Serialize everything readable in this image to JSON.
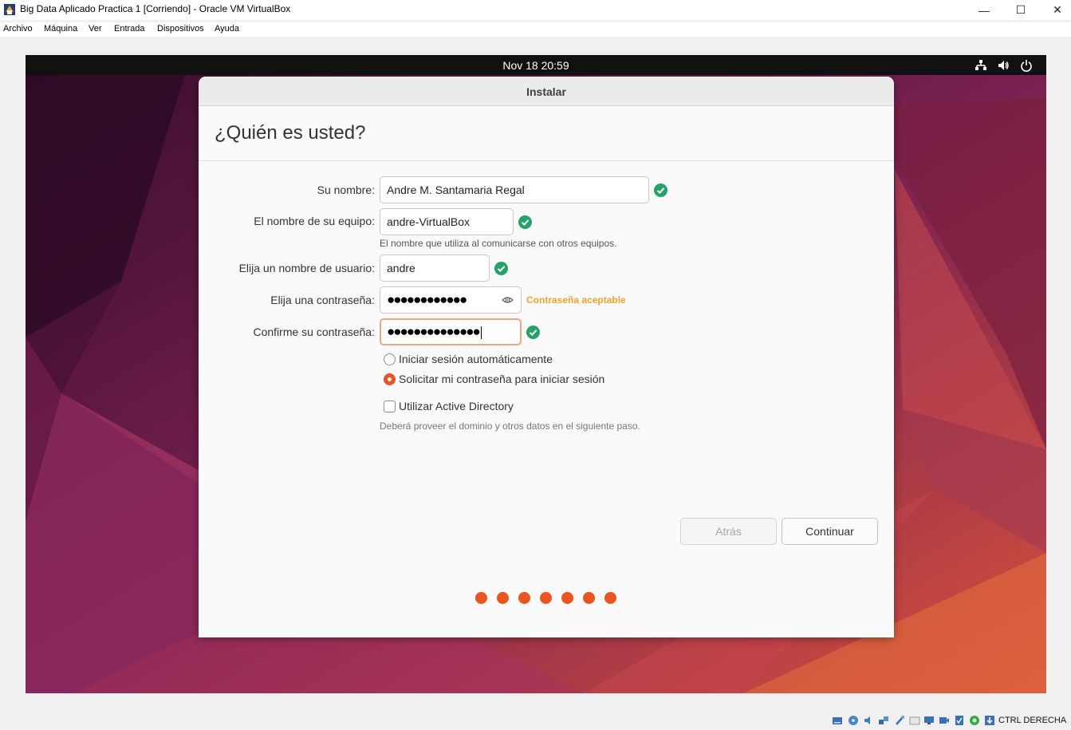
{
  "host": {
    "title": "Big Data Aplicado Practica 1 [Corriendo] - Oracle VM VirtualBox",
    "menu": [
      "Archivo",
      "Máquina",
      "Ver",
      "Entrada",
      "Dispositivos",
      "Ayuda"
    ],
    "window_controls": {
      "minimize": "—",
      "maximize": "☐",
      "close": "✕"
    },
    "host_key": "CTRL DERECHA",
    "status_icons": [
      "hard-disk-icon",
      "optical-drive-icon",
      "audio-icon",
      "network-icon",
      "usb-icon",
      "shared-folder-icon",
      "display-icon",
      "video-capture-icon",
      "recording-icon",
      "cpu-icon",
      "mouse-integration-icon",
      "keyboard-icon"
    ]
  },
  "guest": {
    "clock": "Nov 18  20:59",
    "tray_icons": [
      "network-wired-icon",
      "volume-icon",
      "power-icon"
    ]
  },
  "installer": {
    "window_title": "Instalar",
    "heading": "¿Quién es usted?",
    "fields": {
      "name": {
        "label": "Su nombre:",
        "value": "Andre M. Santamaria Regal"
      },
      "computer": {
        "label": "El nombre de su equipo:",
        "value": "andre-VirtualBox",
        "hint": "El nombre que utiliza al comunicarse con otros equipos."
      },
      "username": {
        "label": "Elija un nombre de usuario:",
        "value": "andre"
      },
      "password": {
        "label": "Elija una contraseña:",
        "value": "●●●●●●●●●●●●",
        "strength": "Contraseña aceptable"
      },
      "confirm": {
        "label": "Confirme su contraseña:",
        "value": "●●●●●●●●●●●●●●"
      }
    },
    "login_options": {
      "auto": "Iniciar sesión automáticamente",
      "ask_password": "Solicitar mi contraseña para iniciar sesión",
      "selected": "ask_password"
    },
    "active_directory": {
      "label": "Utilizar Active Directory",
      "checked": false,
      "hint": "Deberá proveer el dominio y otros datos en el siguiente paso."
    },
    "buttons": {
      "back": "Atrás",
      "continue": "Continuar"
    },
    "progress": {
      "total_steps": 7,
      "accent": "#e95420"
    }
  },
  "colors": {
    "accent": "#e95420",
    "ok_green": "#26a269",
    "strength_orange": "#f5a12a"
  }
}
